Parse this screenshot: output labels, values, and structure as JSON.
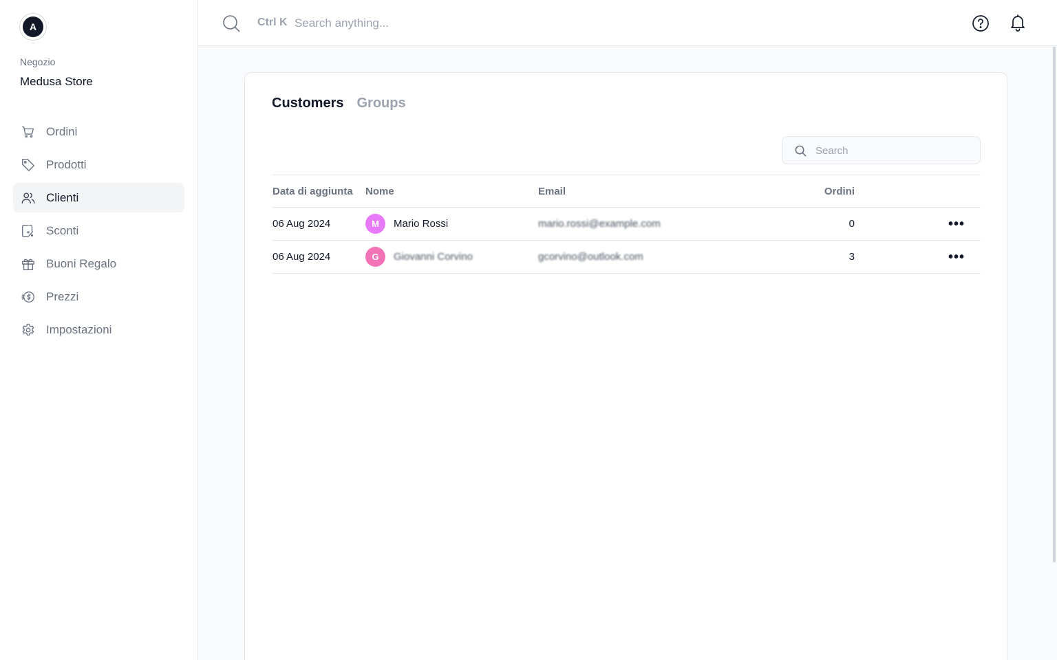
{
  "sidebar": {
    "avatar_initial": "A",
    "store_label": "Negozio",
    "store_name": "Medusa Store",
    "items": [
      {
        "label": "Ordini",
        "icon": "cart-icon"
      },
      {
        "label": "Prodotti",
        "icon": "tag-icon"
      },
      {
        "label": "Clienti",
        "icon": "users-icon",
        "active": true
      },
      {
        "label": "Sconti",
        "icon": "discount-icon"
      },
      {
        "label": "Buoni Regalo",
        "icon": "gift-icon"
      },
      {
        "label": "Prezzi",
        "icon": "coins-icon"
      },
      {
        "label": "Impostazioni",
        "icon": "gear-icon"
      }
    ]
  },
  "topbar": {
    "shortcut": "Ctrl K",
    "search_placeholder": "Search anything...",
    "icons": [
      "search-icon",
      "help-icon",
      "bell-icon"
    ]
  },
  "main": {
    "tabs": [
      {
        "label": "Customers",
        "active": true
      },
      {
        "label": "Groups",
        "active": false
      }
    ],
    "search_placeholder": "Search",
    "table": {
      "headers": {
        "date": "Data di aggiunta",
        "name": "Nome",
        "email": "Email",
        "orders": "Ordini"
      },
      "rows": [
        {
          "date": "06 Aug 2024",
          "initial": "M",
          "avatar_color": "#e879f9",
          "name": "Mario Rossi",
          "email": "mario.rossi@example.com",
          "orders": "0",
          "actions": "•••"
        },
        {
          "date": "06 Aug 2024",
          "initial": "G",
          "avatar_color": "#f472b6",
          "name": "Giovanni Corvino",
          "email": "gcorvino@outlook.com",
          "orders": "3",
          "actions": "•••"
        }
      ]
    }
  },
  "colors": {
    "accent_text": "#111827",
    "muted_text": "#6b7280",
    "border": "#e5e7eb",
    "active_nav_bg": "#f3f4f6"
  }
}
